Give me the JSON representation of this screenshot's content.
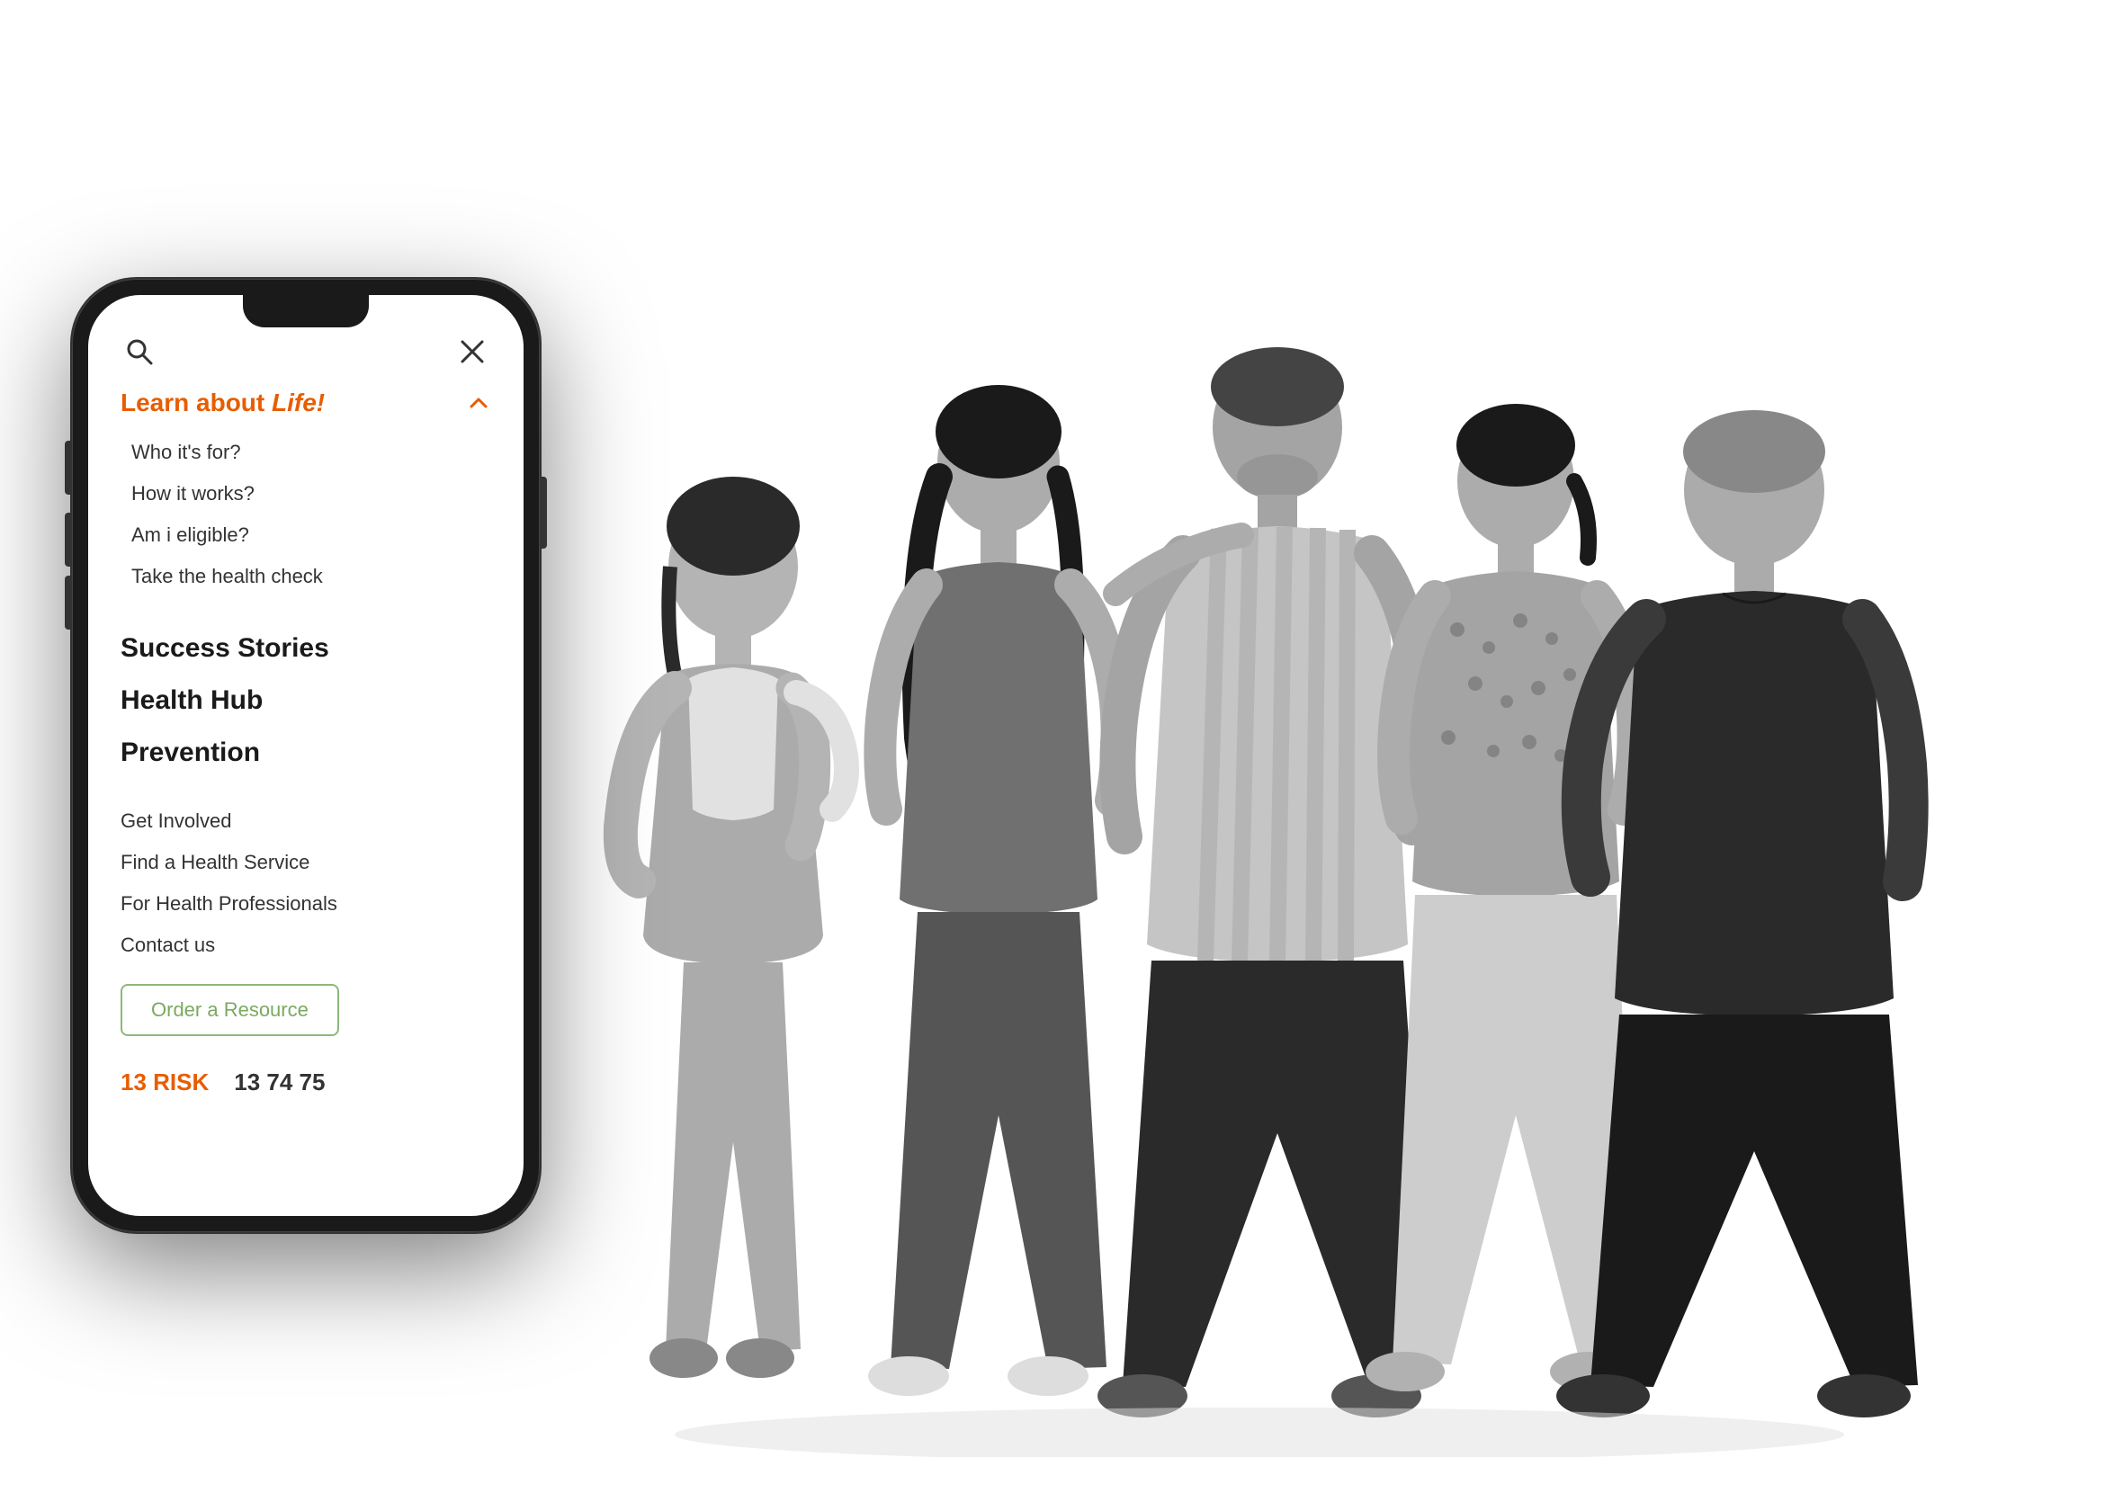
{
  "phone": {
    "header": {
      "search_label": "search",
      "close_label": "close"
    },
    "learn_section": {
      "title": "Learn about ",
      "title_italic": "Life!",
      "chevron": "up",
      "sub_items": [
        {
          "label": "Who it's for?"
        },
        {
          "label": "How it works?"
        },
        {
          "label": "Am i eligible?"
        },
        {
          "label": "Take the health check"
        }
      ]
    },
    "nav_bold": [
      {
        "label": "Success Stories"
      },
      {
        "label": "Health Hub"
      },
      {
        "label": "Prevention"
      }
    ],
    "nav_regular": [
      {
        "label": "Get Involved"
      },
      {
        "label": "Find a Health Service"
      },
      {
        "label": "For Health Professionals"
      },
      {
        "label": "Contact us"
      }
    ],
    "order_button": "Order a Resource",
    "footer": {
      "risk_label": "13 RISK",
      "phone_number": "13 74 75"
    }
  }
}
